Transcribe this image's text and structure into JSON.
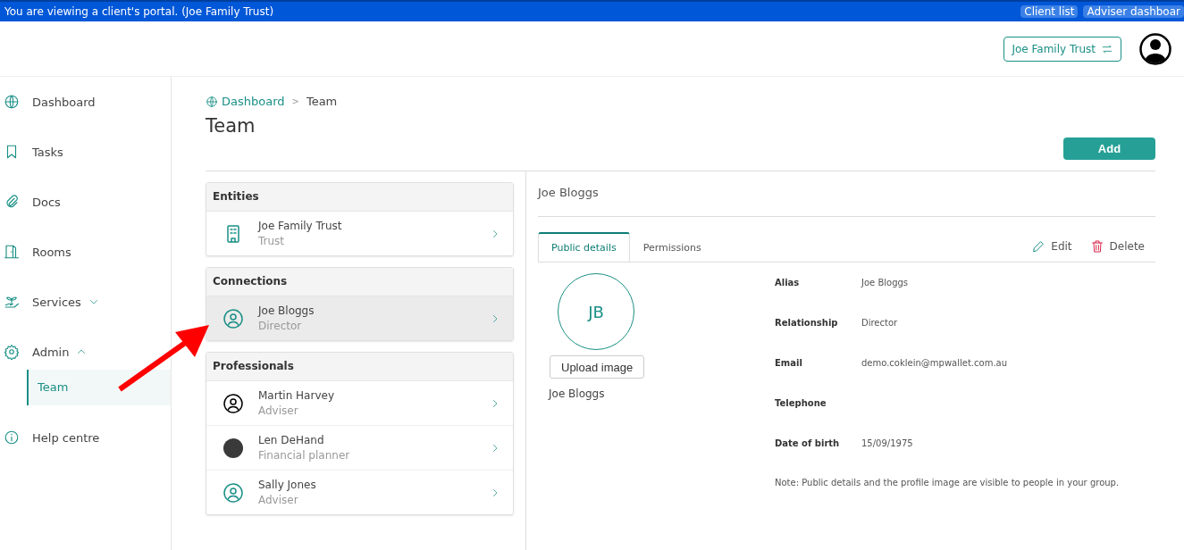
{
  "banner": {
    "message": "You are viewing a client's portal. (Joe Family Trust)",
    "links": [
      "Client list",
      "Adviser dashboar"
    ]
  },
  "header": {
    "entity_switch": "Joe Family Trust"
  },
  "sidebar": {
    "items": [
      {
        "label": "Dashboard"
      },
      {
        "label": "Tasks"
      },
      {
        "label": "Docs"
      },
      {
        "label": "Rooms"
      },
      {
        "label": "Services",
        "expanded": false
      },
      {
        "label": "Admin",
        "expanded": true,
        "children": [
          {
            "label": "Team",
            "selected": true
          }
        ]
      },
      {
        "label": "Help centre"
      }
    ]
  },
  "breadcrumb": {
    "link": "Dashboard",
    "separator": ">",
    "current": "Team"
  },
  "page_title": "Team",
  "add_button": "Add",
  "sections": [
    {
      "title": "Entities",
      "items": [
        {
          "name": "Joe Family Trust",
          "role": "Trust",
          "kind": "entity",
          "selected": false
        }
      ]
    },
    {
      "title": "Connections",
      "items": [
        {
          "name": "Joe Bloggs",
          "role": "Director",
          "kind": "contact",
          "selected": true
        }
      ]
    },
    {
      "title": "Professionals",
      "items": [
        {
          "name": "Martin Harvey",
          "role": "Adviser",
          "kind": "default-avatar",
          "selected": false
        },
        {
          "name": "Len DeHand",
          "role": "Financial planner",
          "kind": "photo",
          "selected": false
        },
        {
          "name": "Sally Jones",
          "role": "Adviser",
          "kind": "contact",
          "selected": false
        }
      ]
    }
  ],
  "detail": {
    "name": "Joe Bloggs",
    "tabs": [
      {
        "label": "Public details",
        "selected": true
      },
      {
        "label": "Permissions",
        "selected": false
      }
    ],
    "actions": [
      {
        "label": "Edit",
        "kind": "edit"
      },
      {
        "label": "Delete",
        "kind": "delete"
      }
    ],
    "initials": "JB",
    "upload_button": "Upload image",
    "display_name": "Joe Bloggs",
    "fields": [
      {
        "label": "Alias",
        "value": "Joe Bloggs"
      },
      {
        "label": "Relationship",
        "value": "Director"
      },
      {
        "label": "Email",
        "value": "demo.coklein@mpwallet.com.au"
      },
      {
        "label": "Telephone"
      },
      {
        "label": "Date of birth",
        "value": "15/09/1975"
      }
    ],
    "note": "Note: Public details and the profile image are visible to people in your group."
  }
}
